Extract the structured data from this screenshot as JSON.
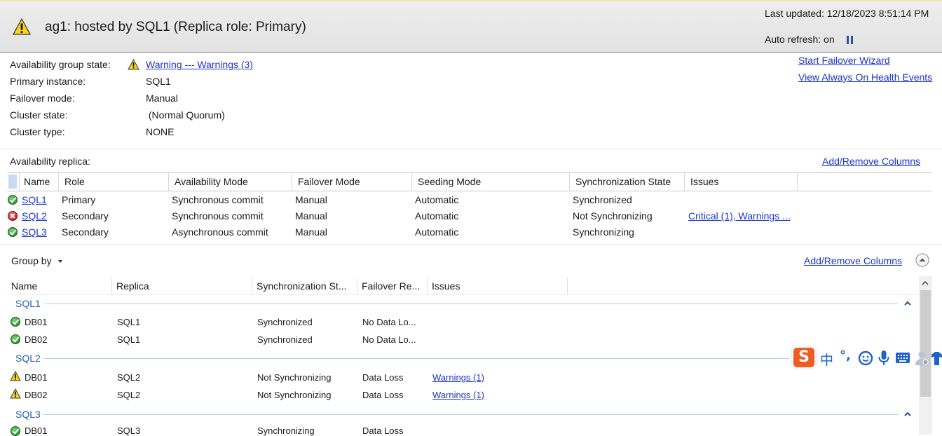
{
  "header": {
    "title": "ag1: hosted by SQL1 (Replica role: Primary)",
    "last_updated": "Last updated: 12/18/2023 8:51:14 PM",
    "auto_refresh": "Auto refresh: on"
  },
  "info": {
    "ag_state_label": "Availability group state:",
    "ag_state_value": "Warning --- Warnings (3)",
    "primary_label": "Primary instance:",
    "primary_value": "SQL1",
    "failover_label": "Failover mode:",
    "failover_value": "Manual",
    "cluster_state_label": "Cluster state:",
    "cluster_state_value": " (Normal Quorum)",
    "cluster_type_label": "Cluster type:",
    "cluster_type_value": "NONE"
  },
  "links": {
    "start_failover": "Start Failover Wizard",
    "view_health": "View Always On Health Events"
  },
  "replicas": {
    "section_label": "Availability replica:",
    "add_remove": "Add/Remove Columns",
    "headers": [
      "Name",
      "Role",
      "Availability Mode",
      "Failover Mode",
      "Seeding Mode",
      "Synchronization State",
      "Issues"
    ],
    "rows": [
      {
        "name": "SQL1",
        "role": "Primary",
        "availability_mode": "Synchronous commit",
        "failover_mode": "Manual",
        "seeding_mode": "Automatic",
        "sync_state": "Synchronized",
        "issues": "",
        "status": "ok"
      },
      {
        "name": "SQL2",
        "role": "Secondary",
        "availability_mode": "Synchronous commit",
        "failover_mode": "Manual",
        "seeding_mode": "Automatic",
        "sync_state": "Not Synchronizing",
        "issues": "Critical (1), Warnings ...",
        "status": "error"
      },
      {
        "name": "SQL3",
        "role": "Secondary",
        "availability_mode": "Asynchronous commit",
        "failover_mode": "Manual",
        "seeding_mode": "Automatic",
        "sync_state": "Synchronizing",
        "issues": "",
        "status": "ok"
      }
    ]
  },
  "databases": {
    "group_by": "Group by",
    "add_remove": "Add/Remove Columns",
    "headers": [
      "Name",
      "Replica",
      "Synchronization St...",
      "Failover Re...",
      "Issues"
    ],
    "groups": [
      {
        "label": "SQL1",
        "rows": [
          {
            "name": "DB01",
            "replica": "SQL1",
            "sync": "Synchronized",
            "failover": "No Data Lo...",
            "issues": "",
            "status": "ok"
          },
          {
            "name": "DB02",
            "replica": "SQL1",
            "sync": "Synchronized",
            "failover": "No Data Lo...",
            "issues": "",
            "status": "ok"
          }
        ]
      },
      {
        "label": "SQL2",
        "rows": [
          {
            "name": "DB01",
            "replica": "SQL2",
            "sync": "Not Synchronizing",
            "failover": "Data Loss",
            "issues": "Warnings (1)",
            "status": "warning"
          },
          {
            "name": "DB02",
            "replica": "SQL2",
            "sync": "Not Synchronizing",
            "failover": "Data Loss",
            "issues": "Warnings (1)",
            "status": "warning"
          }
        ]
      },
      {
        "label": "SQL3",
        "rows": [
          {
            "name": "DB01",
            "replica": "SQL3",
            "sync": "Synchronizing",
            "failover": "Data Loss",
            "issues": "",
            "status": "ok"
          }
        ]
      }
    ]
  },
  "ime": {
    "logo": "S",
    "mode": "中",
    "punct": "°,"
  },
  "colors": {
    "link": "#1a33cc",
    "group_label": "#2a5db0",
    "ok": "#2e9a2e",
    "error": "#c62828",
    "warning": "#f5c400",
    "ime_brand": "#f05a23"
  }
}
